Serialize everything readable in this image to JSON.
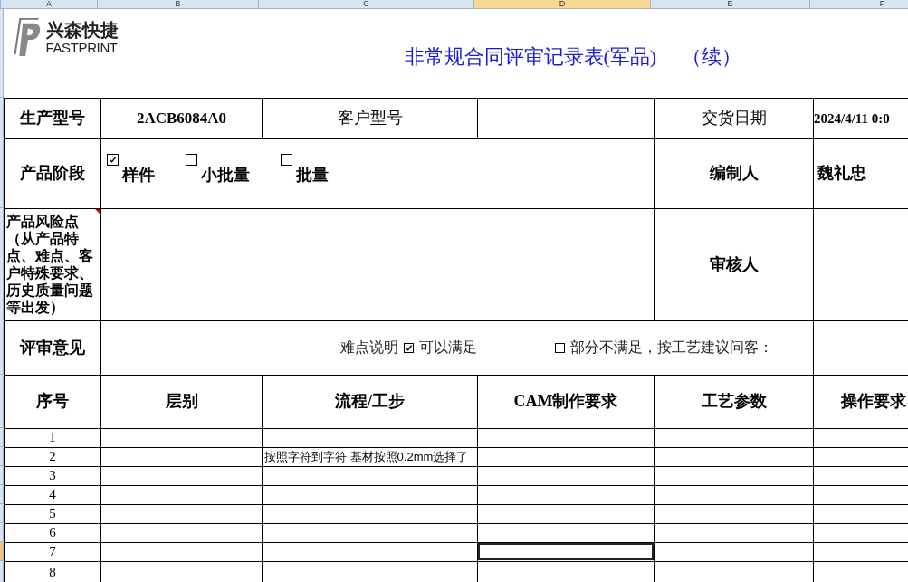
{
  "column_headers": [
    {
      "label": "A",
      "selected": false
    },
    {
      "label": "B",
      "selected": false
    },
    {
      "label": "C",
      "selected": false
    },
    {
      "label": "D",
      "selected": true
    },
    {
      "label": "E",
      "selected": false
    },
    {
      "label": "F",
      "selected": false
    }
  ],
  "logo": {
    "name_cn": "兴森快捷",
    "name_en": "FASTPRINT"
  },
  "title": "非常规合同评审记录表(军品)",
  "title_suffix": "（续）",
  "product_model": {
    "label": "生产型号",
    "value": "2ACB6084A0"
  },
  "customer_model": {
    "label": "客户型号"
  },
  "delivery_date": {
    "label": "交货日期",
    "value": "2024/4/11 0:0"
  },
  "product_stage": {
    "label": "产品阶段",
    "options": [
      {
        "label": "样件",
        "checked": true
      },
      {
        "label": "小批量",
        "checked": false
      },
      {
        "label": "批量",
        "checked": false
      }
    ]
  },
  "preparer": {
    "label": "编制人",
    "value": "魏礼忠"
  },
  "risk_points": {
    "label": "产品风险点（从产品特点、难点、客户特殊要求、历史质量问题等出发）",
    "has_comment": true
  },
  "reviewer": {
    "label": "审核人"
  },
  "review_opinion": {
    "label": "评审意见",
    "items": [
      {
        "kind": "label",
        "text": "难点说明"
      },
      {
        "kind": "checkbox",
        "text": "可以满足",
        "checked": true
      },
      {
        "kind": "checkbox",
        "text": "部分不满足，按工艺建议问客：",
        "checked": false
      }
    ]
  },
  "table": {
    "columns": [
      "序号",
      "层别",
      "流程/工步",
      "CAM制作要求",
      "工艺参数",
      "操作要求"
    ],
    "rows": [
      {
        "number": "1",
        "selected": false
      },
      {
        "number": "2",
        "flow_step": "按照字符到字符 基材按照0.2mm选择了",
        "selected": false
      },
      {
        "number": "3",
        "selected": false
      },
      {
        "number": "4",
        "selected": false
      },
      {
        "number": "5",
        "selected": false
      },
      {
        "number": "6",
        "selected": false
      },
      {
        "number": "7",
        "selected": true
      },
      {
        "number": "8",
        "selected": false
      }
    ]
  }
}
